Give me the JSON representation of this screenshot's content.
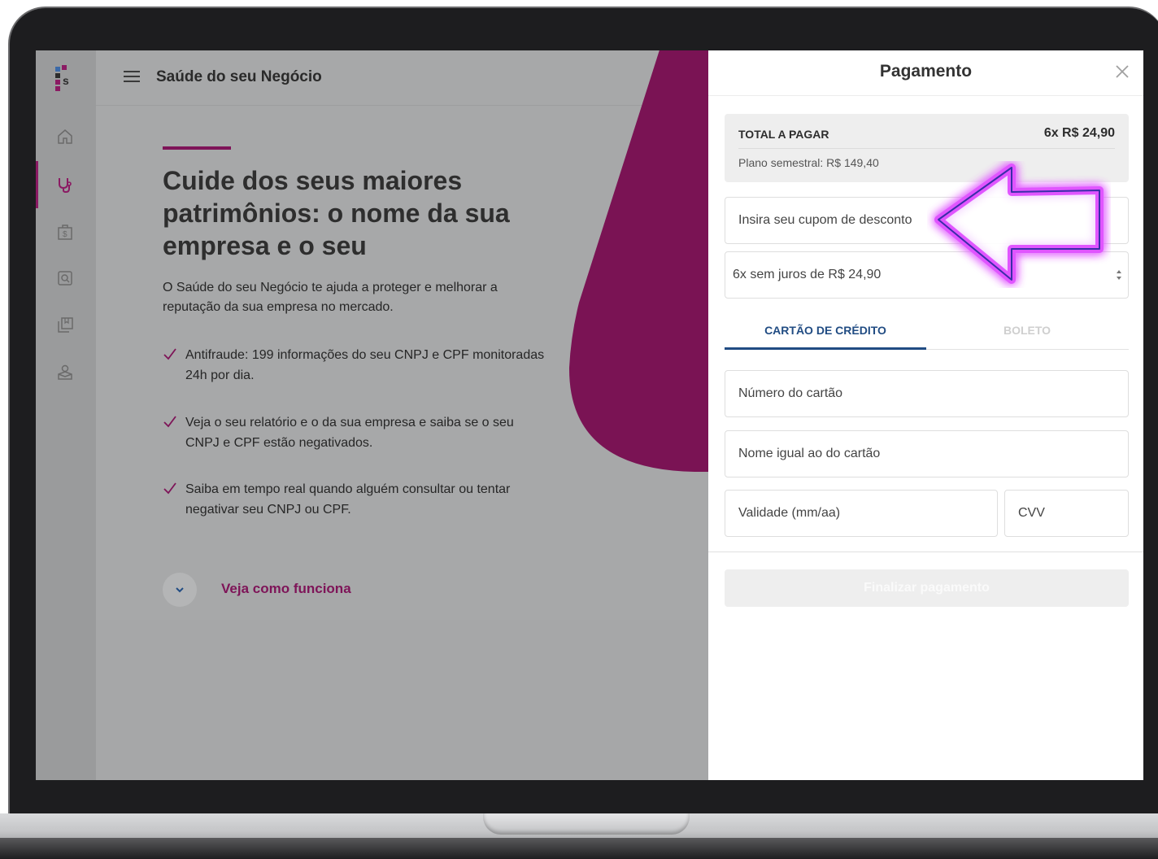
{
  "app": {
    "title": "Saúde do seu Negócio"
  },
  "sidebar": {
    "items": [
      {
        "name": "home-icon"
      },
      {
        "name": "stethoscope-icon",
        "active": true
      },
      {
        "name": "money-bag-icon"
      },
      {
        "name": "search-document-icon"
      },
      {
        "name": "copy-icon"
      },
      {
        "name": "user-box-icon"
      }
    ]
  },
  "hero": {
    "title": "Cuide dos seus maiores patrimônios: o nome da sua empresa e o seu",
    "description": "O Saúde do seu Negócio te ajuda a proteger e melhorar a reputação da sua empresa no mercado.",
    "features": [
      "Antifraude: 199 informações do seu CNPJ e CPF monitoradas 24h por dia.",
      "Veja o seu relatório e o da sua empresa e saiba se o seu CNPJ e CPF estão negativados.",
      "Saiba em tempo real quando alguém consultar ou tentar negativar seu CNPJ ou CPF."
    ],
    "how_it_works": "Veja como funciona"
  },
  "payment": {
    "title": "Pagamento",
    "total_label": "TOTAL A PAGAR",
    "total_value": "6x R$ 24,90",
    "plan": "Plano semestral: R$ 149,40",
    "coupon_placeholder": "Insira seu cupom de desconto",
    "installments_selected": "6x sem juros de R$ 24,90",
    "tabs": [
      {
        "label": "CARTÃO DE CRÉDITO",
        "active": true
      },
      {
        "label": "BOLETO",
        "active": false
      }
    ],
    "card_number_placeholder": "Número do cartão",
    "card_name_placeholder": "Nome igual ao do cartão",
    "expiry_placeholder": "Validade (mm/aa)",
    "cvv_placeholder": "CVV",
    "submit_label": "Finalizar pagamento"
  },
  "colors": {
    "brand_purple": "#7e1458",
    "tab_blue": "#214c83",
    "overlay_gray": "#a7a8a9"
  }
}
